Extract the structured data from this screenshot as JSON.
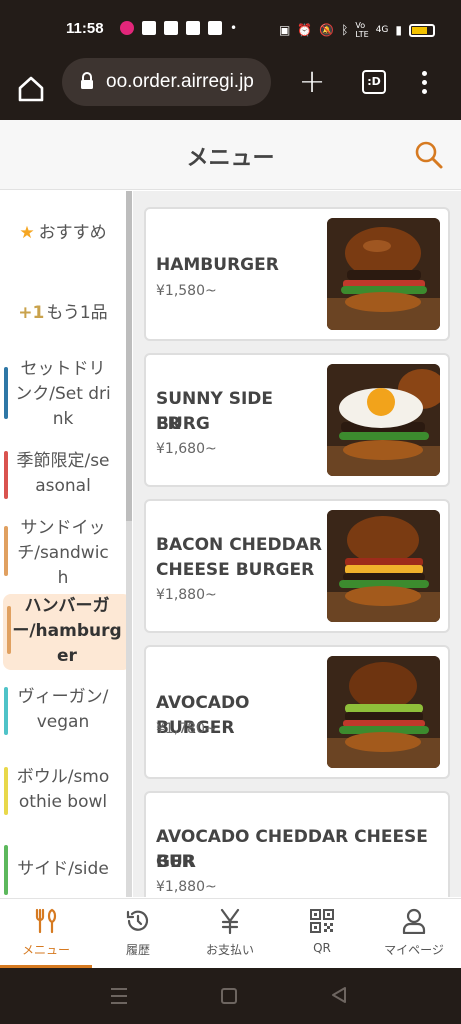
{
  "status_bar": {
    "time": "11:58",
    "network": "4G"
  },
  "browser": {
    "url": "oo.order.airregi.jp",
    "tabs_label": ":D"
  },
  "header": {
    "title": "メニュー"
  },
  "categories": [
    {
      "label": "おすすめ",
      "prefix": "★",
      "accent": ""
    },
    {
      "label": "もう1品",
      "prefix": "+1",
      "accent": ""
    },
    {
      "label": "セットドリンク/Set drink",
      "line1": "セットドリ",
      "line2": "ンク/Set dri",
      "line3": "nk",
      "accent": "#2e77a6"
    },
    {
      "label": "季節限定/seasonal",
      "line1": "季節限定/se",
      "line2": "asonal",
      "accent": "#d9534f"
    },
    {
      "label": "サンドイッチ/sandwich",
      "line1": "サンドイッ",
      "line2": "チ/sandwic",
      "line3": "h",
      "accent": "#e0a060"
    },
    {
      "label": "ハンバーガー/hamburger",
      "line1": "ハンバーガ",
      "line2": "ー/hamburg",
      "line3": "er",
      "accent": "#e0a060",
      "active": true
    },
    {
      "label": "ヴィーガン/vegan",
      "line1": "ヴィーガン/",
      "line2": "vegan",
      "accent": "#4fc3c8"
    },
    {
      "label": "ボウル/smoothie bowl",
      "line1": "ボウル/smo",
      "line2": "othie bowl",
      "accent": "#e8d84a"
    },
    {
      "label": "サイド/side",
      "line1": "サイド/side",
      "accent": "#5cb85c"
    }
  ],
  "menu_items": [
    {
      "name": "HAMBURGER",
      "name_line1": "HAMBURGER",
      "name_line2": "",
      "price": "¥1,580~"
    },
    {
      "name": "SUNNY SIDE BURGER",
      "name_line1": "SUNNY SIDE BURG",
      "name_line2": "ER",
      "price": "¥1,680~"
    },
    {
      "name": "BACON CHEDDAR CHEESE BURGER",
      "name_line1": "BACON CHEDDAR",
      "name_line2": "CHEESE BURGER",
      "price": "¥1,880~"
    },
    {
      "name": "AVOCADO BURGER",
      "name_line1": "AVOCADO BURGER",
      "name_line2": "",
      "price": "¥1,780~"
    },
    {
      "name": "AVOCADO CHEDDAR CHEESE BURGER",
      "name_line1": "AVOCADO CHEDDAR CHEESE BUR",
      "name_line2": "GER",
      "price": "¥1,880~"
    }
  ],
  "bottom_nav": [
    {
      "label": "メニュー",
      "icon": "fork-knife-icon",
      "active": true
    },
    {
      "label": "履歴",
      "icon": "history-icon"
    },
    {
      "label": "お支払い",
      "icon": "yen-icon"
    },
    {
      "label": "QR",
      "icon": "qr-code-icon"
    },
    {
      "label": "マイページ",
      "icon": "person-icon"
    }
  ],
  "colors": {
    "accent": "#d67a21",
    "active_category_bg": "#fde8d5",
    "browser_bg": "#231c18"
  }
}
